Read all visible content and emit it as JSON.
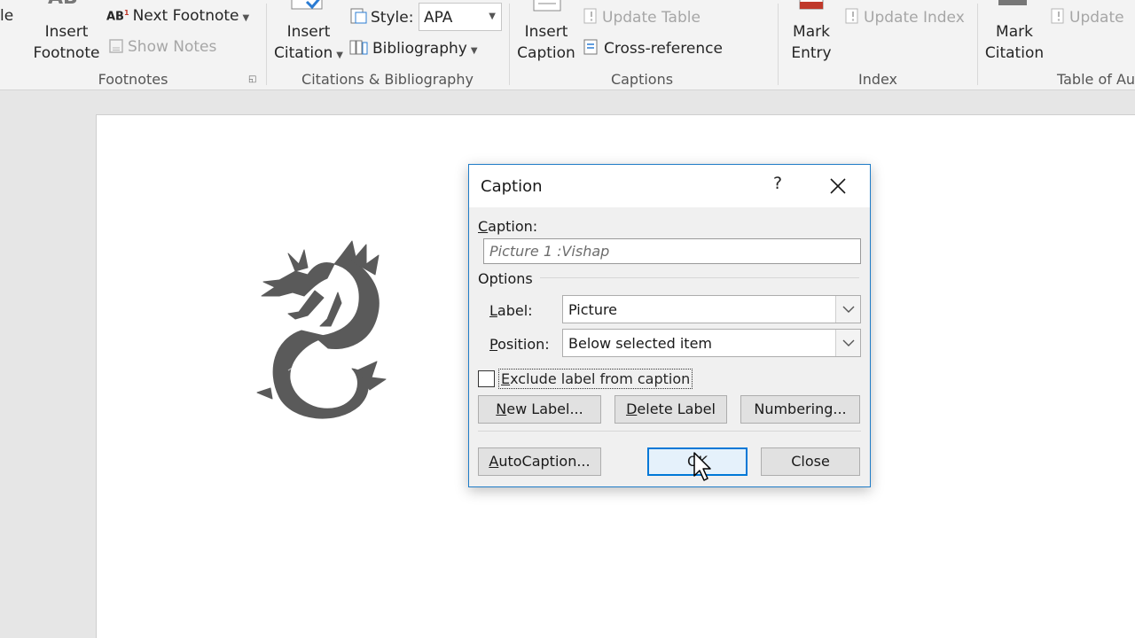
{
  "ribbon": {
    "partial_left_label": "le",
    "insert_footnote": [
      "Insert",
      "Footnote"
    ],
    "next_footnote": "Next Footnote",
    "show_notes": "Show Notes",
    "footnotes_group": "Footnotes",
    "insert_citation": [
      "Insert",
      "Citation"
    ],
    "style_label": "Style:",
    "style_value": "APA",
    "bibliography": "Bibliography",
    "citations_group": "Citations & Bibliography",
    "insert_caption": [
      "Insert",
      "Caption"
    ],
    "update_table": "Update Table",
    "cross_reference": "Cross-reference",
    "captions_group": "Captions",
    "mark_entry": [
      "Mark",
      "Entry"
    ],
    "update_index": "Update Index",
    "index_group": "Index",
    "mark_citation": [
      "Mark",
      "Citation"
    ],
    "update_toa": "Update",
    "toa_group": "Table of Au"
  },
  "dialog": {
    "title": "Caption",
    "help": "?",
    "caption_label": {
      "key": "C",
      "rest": "aption:"
    },
    "caption_value": "Picture 1 :Vishap",
    "options_heading": "Options",
    "label_label": {
      "key": "L",
      "rest": "abel:"
    },
    "label_value": "Picture",
    "position_label": {
      "key": "P",
      "rest": "osition:"
    },
    "position_value": "Below selected item",
    "exclude_label": {
      "key": "E",
      "rest": "xclude label from caption"
    },
    "exclude_checked": false,
    "buttons": {
      "new_label": {
        "key": "N",
        "rest": "ew Label..."
      },
      "delete_label": {
        "key": "D",
        "rest": "elete Label"
      },
      "numbering": {
        "key": "U",
        "rest": "Numbering..."
      },
      "autocaption": {
        "key": "A",
        "rest": "utoCaption..."
      },
      "ok": "OK",
      "close": "Close"
    }
  },
  "icons": {
    "footnote_icon": "ab-superscript-icon",
    "show_notes_icon": "notes-icon",
    "style_icon": "style-icon",
    "bibliography_icon": "book-icon",
    "cross_reference_icon": "cross-reference-icon",
    "update_icon": "exclamation-doc-icon",
    "dragon_image": "dragon-silhouette"
  },
  "colors": {
    "accent": "#0078d7",
    "dialog_border": "#1f7cc7",
    "dragon": "#5a5a5a"
  }
}
